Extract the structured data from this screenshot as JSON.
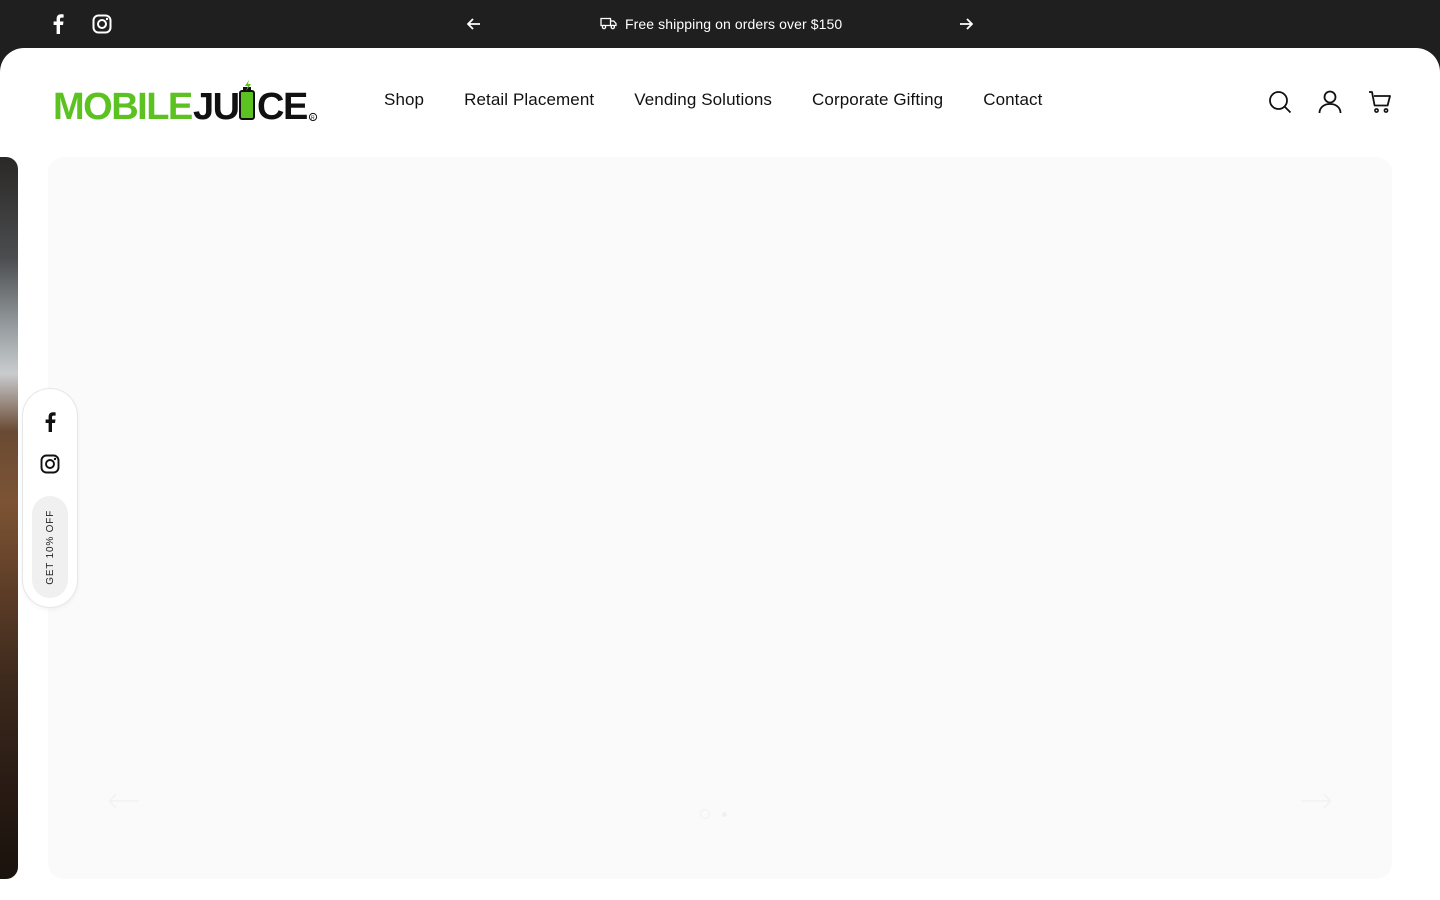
{
  "announcement": {
    "message": "Free shipping on orders over $150",
    "icons": [
      "facebook-icon",
      "instagram-icon",
      "arrow-left-icon",
      "truck-icon",
      "arrow-right-icon"
    ]
  },
  "brand": {
    "name": "MOBILE JUICE",
    "logo_green": "#5cc221",
    "logo_dark": "#111111"
  },
  "nav": {
    "items": [
      {
        "label": "Shop"
      },
      {
        "label": "Retail Placement"
      },
      {
        "label": "Vending Solutions"
      },
      {
        "label": "Corporate Gifting"
      },
      {
        "label": "Contact"
      }
    ]
  },
  "header_icons": [
    "search-icon",
    "account-icon",
    "cart-icon"
  ],
  "slideshow": {
    "slide_count": 2,
    "active_slide": 1
  },
  "floating_widget": {
    "discount_label": "GET 10% OFF",
    "icons": [
      "facebook-icon",
      "instagram-icon"
    ]
  },
  "colors": {
    "topbar": "#1f1f1f",
    "page_bg": "#ffffff",
    "slide_bg": "#fafafa"
  }
}
